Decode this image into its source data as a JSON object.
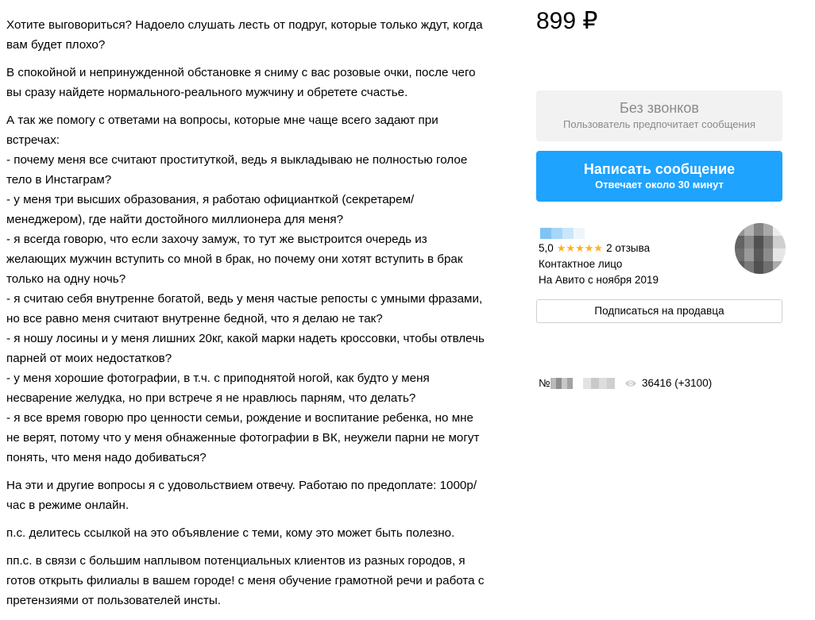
{
  "description": {
    "paragraphs": [
      "Хотите выговориться? Надоело слушать лесть от подруг, которые только ждут, когда\nвам будет плохо?",
      "В спокойной и непринужденной обстановке я сниму с вас розовые очки, после чего\nвы сразу найдете нормального-реального мужчину и обретете счастье.",
      "А так же помогу с ответами на вопросы, которые мне чаще всего задают при\nвстречах:\n- почему меня все считают проституткой, ведь я выкладываю не полностью голое\nтело в Инстаграм?\n- у меня три высших образования, я работаю официанткой (секретарем/\nменеджером), где найти достойного миллионера для меня?\n- я всегда говорю, что если захочу замуж, то тут же выстроится очередь из\nжелающих мужчин вступить со мной в брак, но почему они хотят вступить в брак\nтолько на одну ночь?\n- я считаю себя внутренне богатой, ведь у меня частые репосты с умными фразами,\nно все равно меня считают внутренне бедной, что я делаю не так?\n- я ношу лосины и у меня лишних 20кг, какой марки надеть кроссовки, чтобы отвлечь\nпарней от моих недостатков?\n- у меня хорошие фотографии, в т.ч. с приподнятой ногой, как будто у меня\nнесварение желудка, но при встрече я не нравлюсь парням, что делать?\n- я все время говорю про ценности семьи, рождение и воспитание ребенка, но мне\nне верят, потому что у меня обнаженные фотографии в ВК, неужели парни не могут\nпонять, что меня надо добиваться?",
      "На эти и другие вопросы я с удовольствием отвечу. Работаю по предоплате: 1000р/\nчас в режиме онлайн.",
      "п.с. делитесь ссылкой на это объявление с теми, кому это может быть полезно.",
      "пп.с. в связи с большим наплывом потенциальных клиентов из разных городов, я\nготов открыть филиалы в вашем городе! с меня обучение грамотной речи и работа с\nпретензиями от пользователей инсты."
    ]
  },
  "price": "899 ₽",
  "no_calls": {
    "title": "Без звонков",
    "subtitle": "Пользователь предпочитает сообщения"
  },
  "message_button": {
    "title": "Написать сообщение",
    "subtitle": "Отвечает около 30 минут"
  },
  "seller": {
    "rating": "5,0",
    "stars": "★★★★★",
    "reviews": "2 отзыва",
    "contact": "Контактное лицо",
    "since": "На Авито с ноября 2019"
  },
  "subscribe_label": "Подписаться на продавца",
  "listing": {
    "number_prefix": "№",
    "views": "36416 (+3100)"
  },
  "colors": {
    "accent": "#1ea3ff",
    "star": "#ffb021",
    "muted": "#8a8a8a"
  }
}
